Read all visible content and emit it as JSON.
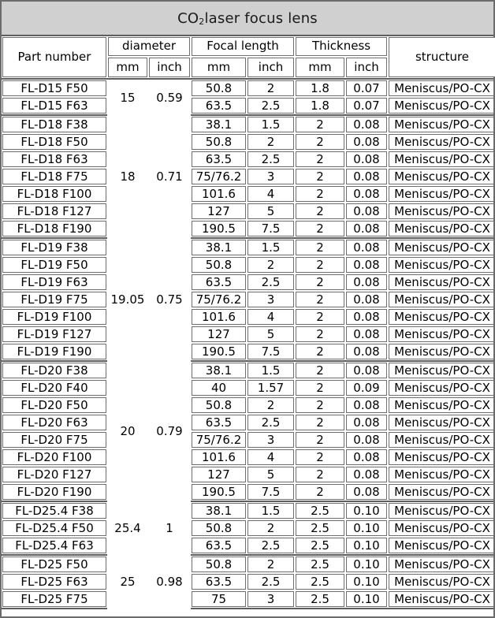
{
  "table": {
    "title_prefix": "CO",
    "title_sub": "2",
    "title_suffix": "laser focus lens",
    "title_full": "CO2laser focus lens",
    "header": {
      "part_number": "Part number",
      "diameter": "diameter",
      "focal_length": "Focal length",
      "thickness": "Thickness",
      "structure": "structure",
      "unit_mm": "mm",
      "unit_inch": "inch",
      "diameter_mm": "mm",
      "diameter_inch": "inch",
      "focal_mm": "mm",
      "focal_inch": "inch",
      "thickness_mm": "mm",
      "thickness_inch": "inch"
    },
    "groups": [
      {
        "diameter_mm": "15",
        "diameter_inch": "0.59",
        "rows": [
          {
            "part": "FL-D15 F50",
            "focal_mm": "50.8",
            "focal_inch": "2",
            "thk_mm": "1.8",
            "thk_inch": "0.07",
            "structure": "Meniscus/PO-CX"
          },
          {
            "part": "FL-D15 F63",
            "focal_mm": "63.5",
            "focal_inch": "2.5",
            "thk_mm": "1.8",
            "thk_inch": "0.07",
            "structure": "Meniscus/PO-CX"
          }
        ]
      },
      {
        "diameter_mm": "18",
        "diameter_inch": "0.71",
        "rows": [
          {
            "part": "FL-D18 F38",
            "focal_mm": "38.1",
            "focal_inch": "1.5",
            "thk_mm": "2",
            "thk_inch": "0.08",
            "structure": "Meniscus/PO-CX"
          },
          {
            "part": "FL-D18 F50",
            "focal_mm": "50.8",
            "focal_inch": "2",
            "thk_mm": "2",
            "thk_inch": "0.08",
            "structure": "Meniscus/PO-CX"
          },
          {
            "part": "FL-D18 F63",
            "focal_mm": "63.5",
            "focal_inch": "2.5",
            "thk_mm": "2",
            "thk_inch": "0.08",
            "structure": "Meniscus/PO-CX"
          },
          {
            "part": "FL-D18 F75",
            "focal_mm": "75/76.2",
            "focal_inch": "3",
            "thk_mm": "2",
            "thk_inch": "0.08",
            "structure": "Meniscus/PO-CX"
          },
          {
            "part": "FL-D18 F100",
            "focal_mm": "101.6",
            "focal_inch": "4",
            "thk_mm": "2",
            "thk_inch": "0.08",
            "structure": "Meniscus/PO-CX"
          },
          {
            "part": "FL-D18 F127",
            "focal_mm": "127",
            "focal_inch": "5",
            "thk_mm": "2",
            "thk_inch": "0.08",
            "structure": "Meniscus/PO-CX"
          },
          {
            "part": "FL-D18 F190",
            "focal_mm": "190.5",
            "focal_inch": "7.5",
            "thk_mm": "2",
            "thk_inch": "0.08",
            "structure": "Meniscus/PO-CX"
          }
        ]
      },
      {
        "diameter_mm": "19.05",
        "diameter_inch": "0.75",
        "rows": [
          {
            "part": "FL-D19 F38",
            "focal_mm": "38.1",
            "focal_inch": "1.5",
            "thk_mm": "2",
            "thk_inch": "0.08",
            "structure": "Meniscus/PO-CX"
          },
          {
            "part": "FL-D19 F50",
            "focal_mm": "50.8",
            "focal_inch": "2",
            "thk_mm": "2",
            "thk_inch": "0.08",
            "structure": "Meniscus/PO-CX"
          },
          {
            "part": "FL-D19 F63",
            "focal_mm": "63.5",
            "focal_inch": "2.5",
            "thk_mm": "2",
            "thk_inch": "0.08",
            "structure": "Meniscus/PO-CX"
          },
          {
            "part": "FL-D19 F75",
            "focal_mm": "75/76.2",
            "focal_inch": "3",
            "thk_mm": "2",
            "thk_inch": "0.08",
            "structure": "Meniscus/PO-CX"
          },
          {
            "part": "FL-D19 F100",
            "focal_mm": "101.6",
            "focal_inch": "4",
            "thk_mm": "2",
            "thk_inch": "0.08",
            "structure": "Meniscus/PO-CX"
          },
          {
            "part": "FL-D19 F127",
            "focal_mm": "127",
            "focal_inch": "5",
            "thk_mm": "2",
            "thk_inch": "0.08",
            "structure": "Meniscus/PO-CX"
          },
          {
            "part": "FL-D19 F190",
            "focal_mm": "190.5",
            "focal_inch": "7.5",
            "thk_mm": "2",
            "thk_inch": "0.08",
            "structure": "Meniscus/PO-CX"
          }
        ]
      },
      {
        "diameter_mm": "20",
        "diameter_inch": "0.79",
        "rows": [
          {
            "part": "FL-D20 F38",
            "focal_mm": "38.1",
            "focal_inch": "1.5",
            "thk_mm": "2",
            "thk_inch": "0.08",
            "structure": "Meniscus/PO-CX"
          },
          {
            "part": "FL-D20 F40",
            "focal_mm": "40",
            "focal_inch": "1.57",
            "thk_mm": "2",
            "thk_inch": "0.09",
            "structure": "Meniscus/PO-CX"
          },
          {
            "part": "FL-D20 F50",
            "focal_mm": "50.8",
            "focal_inch": "2",
            "thk_mm": "2",
            "thk_inch": "0.08",
            "structure": "Meniscus/PO-CX"
          },
          {
            "part": "FL-D20 F63",
            "focal_mm": "63.5",
            "focal_inch": "2.5",
            "thk_mm": "2",
            "thk_inch": "0.08",
            "structure": "Meniscus/PO-CX"
          },
          {
            "part": "FL-D20 F75",
            "focal_mm": "75/76.2",
            "focal_inch": "3",
            "thk_mm": "2",
            "thk_inch": "0.08",
            "structure": "Meniscus/PO-CX"
          },
          {
            "part": "FL-D20 F100",
            "focal_mm": "101.6",
            "focal_inch": "4",
            "thk_mm": "2",
            "thk_inch": "0.08",
            "structure": "Meniscus/PO-CX"
          },
          {
            "part": "FL-D20 F127",
            "focal_mm": "127",
            "focal_inch": "5",
            "thk_mm": "2",
            "thk_inch": "0.08",
            "structure": "Meniscus/PO-CX"
          },
          {
            "part": "FL-D20 F190",
            "focal_mm": "190.5",
            "focal_inch": "7.5",
            "thk_mm": "2",
            "thk_inch": "0.08",
            "structure": "Meniscus/PO-CX"
          }
        ]
      },
      {
        "diameter_mm": "25.4",
        "diameter_inch": "1",
        "rows": [
          {
            "part": "FL-D25.4 F38",
            "focal_mm": "38.1",
            "focal_inch": "1.5",
            "thk_mm": "2.5",
            "thk_inch": "0.10",
            "structure": "Meniscus/PO-CX"
          },
          {
            "part": "FL-D25.4 F50",
            "focal_mm": "50.8",
            "focal_inch": "2",
            "thk_mm": "2.5",
            "thk_inch": "0.10",
            "structure": "Meniscus/PO-CX"
          },
          {
            "part": "FL-D25.4 F63",
            "focal_mm": "63.5",
            "focal_inch": "2.5",
            "thk_mm": "2.5",
            "thk_inch": "0.10",
            "structure": "Meniscus/PO-CX"
          }
        ]
      },
      {
        "diameter_mm": "25",
        "diameter_inch": "0.98",
        "rows": [
          {
            "part": "FL-D25 F50",
            "focal_mm": "50.8",
            "focal_inch": "2",
            "thk_mm": "2.5",
            "thk_inch": "0.10",
            "structure": "Meniscus/PO-CX"
          },
          {
            "part": "FL-D25 F63",
            "focal_mm": "63.5",
            "focal_inch": "2.5",
            "thk_mm": "2.5",
            "thk_inch": "0.10",
            "structure": "Meniscus/PO-CX"
          },
          {
            "part": "FL-D25 F75",
            "focal_mm": "75",
            "focal_inch": "3",
            "thk_mm": "2.5",
            "thk_inch": "0.10",
            "structure": "Meniscus/PO-CX"
          }
        ]
      }
    ]
  },
  "colors": {
    "title_background": "#d0d0d0",
    "border": "#6e6e6e",
    "border_strong": "#5e5e5e",
    "text": "#000000",
    "cell_background": "#ffffff"
  }
}
